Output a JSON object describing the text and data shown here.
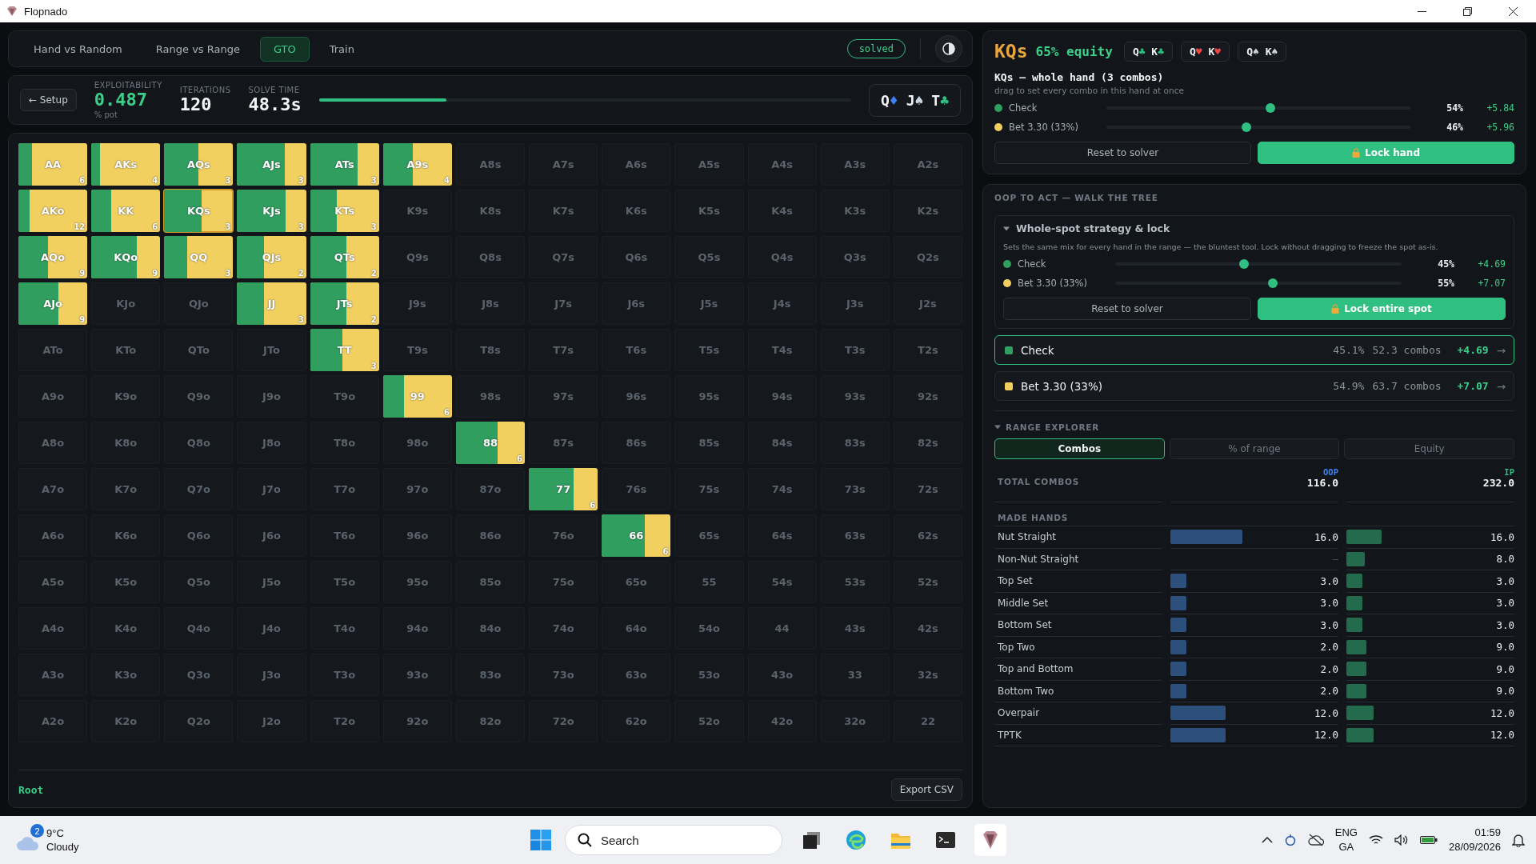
{
  "window": {
    "title": "Flopnado"
  },
  "nav": {
    "tabs": [
      {
        "label": "Hand vs Random",
        "selected": false
      },
      {
        "label": "Range vs Range",
        "selected": false
      },
      {
        "label": "GTO",
        "selected": true
      },
      {
        "label": "Train",
        "selected": false
      }
    ],
    "status": "solved"
  },
  "stats": {
    "back": "← Setup",
    "exploitability": {
      "label": "EXPLOITABILITY",
      "value": "0.487",
      "unit": "% pot"
    },
    "iterations": {
      "label": "ITERATIONS",
      "value": "120"
    },
    "solve_time": {
      "label": "SOLVE TIME",
      "value": "48.3s"
    },
    "progress": {
      "level": 0.24
    },
    "board": [
      {
        "rank": "Q",
        "suit": "♦",
        "color": "#3b82f6"
      },
      {
        "rank": "J",
        "suit": "♠",
        "color": "#cbd5e1"
      },
      {
        "rank": "T",
        "suit": "♣",
        "color": "#2fbf80"
      }
    ]
  },
  "grid": {
    "rows": [
      [
        {
          "label": "AA",
          "selected": false,
          "level": 0.2,
          "count": "6"
        },
        {
          "label": "AKs",
          "selected": false,
          "level": 0.13,
          "count": "4"
        },
        {
          "label": "AQs",
          "selected": false,
          "level": 0.5,
          "count": "3"
        },
        {
          "label": "AJs",
          "selected": false,
          "level": 0.69,
          "count": "3"
        },
        {
          "label": "ATs",
          "selected": false,
          "level": 0.69,
          "count": "3"
        },
        {
          "label": "A9s",
          "selected": false,
          "level": 0.43,
          "count": "4"
        },
        {
          "label": "A8s",
          "selected": false
        },
        {
          "label": "A7s",
          "selected": false
        },
        {
          "label": "A6s",
          "selected": false
        },
        {
          "label": "A5s",
          "selected": false
        },
        {
          "label": "A4s",
          "selected": false
        },
        {
          "label": "A3s",
          "selected": false
        },
        {
          "label": "A2s",
          "selected": false
        }
      ],
      [
        {
          "label": "AKo",
          "selected": false,
          "level": 0.16,
          "count": "12"
        },
        {
          "label": "KK",
          "selected": false,
          "level": 0.29,
          "count": "6"
        },
        {
          "label": "KQs",
          "selected": true,
          "level": 0.54,
          "count": "3"
        },
        {
          "label": "KJs",
          "selected": false,
          "level": 0.7,
          "count": "3"
        },
        {
          "label": "KTs",
          "selected": false,
          "level": 0.39,
          "count": "3"
        },
        {
          "label": "K9s",
          "selected": false
        },
        {
          "label": "K8s",
          "selected": false
        },
        {
          "label": "K7s",
          "selected": false
        },
        {
          "label": "K6s",
          "selected": false
        },
        {
          "label": "K5s",
          "selected": false
        },
        {
          "label": "K4s",
          "selected": false
        },
        {
          "label": "K3s",
          "selected": false
        },
        {
          "label": "K2s",
          "selected": false
        }
      ],
      [
        {
          "label": "AQo",
          "selected": false,
          "level": 0.43,
          "count": "9"
        },
        {
          "label": "KQo",
          "selected": false,
          "level": 0.66,
          "count": "9"
        },
        {
          "label": "QQ",
          "selected": false,
          "level": 0.33,
          "count": "3"
        },
        {
          "label": "QJs",
          "selected": false,
          "level": 0.39,
          "count": "2"
        },
        {
          "label": "QTs",
          "selected": false,
          "level": 0.53,
          "count": "2"
        },
        {
          "label": "Q9s",
          "selected": false
        },
        {
          "label": "Q8s",
          "selected": false
        },
        {
          "label": "Q7s",
          "selected": false
        },
        {
          "label": "Q6s",
          "selected": false
        },
        {
          "label": "Q5s",
          "selected": false
        },
        {
          "label": "Q4s",
          "selected": false
        },
        {
          "label": "Q3s",
          "selected": false
        },
        {
          "label": "Q2s",
          "selected": false
        }
      ],
      [
        {
          "label": "AJo",
          "selected": false,
          "level": 0.58,
          "count": "9"
        },
        {
          "label": "KJo",
          "selected": false
        },
        {
          "label": "QJo",
          "selected": false
        },
        {
          "label": "JJ",
          "selected": false,
          "level": 0.39,
          "count": "3"
        },
        {
          "label": "JTs",
          "selected": false,
          "level": 0.53,
          "count": "2"
        },
        {
          "label": "J9s",
          "selected": false
        },
        {
          "label": "J8s",
          "selected": false
        },
        {
          "label": "J7s",
          "selected": false
        },
        {
          "label": "J6s",
          "selected": false
        },
        {
          "label": "J5s",
          "selected": false
        },
        {
          "label": "J4s",
          "selected": false
        },
        {
          "label": "J3s",
          "selected": false
        },
        {
          "label": "J2s",
          "selected": false
        }
      ],
      [
        {
          "label": "ATo",
          "selected": false
        },
        {
          "label": "KTo",
          "selected": false
        },
        {
          "label": "QTo",
          "selected": false
        },
        {
          "label": "JTo",
          "selected": false
        },
        {
          "label": "TT",
          "selected": false,
          "level": 0.47,
          "count": "3"
        },
        {
          "label": "T9s",
          "selected": false
        },
        {
          "label": "T8s",
          "selected": false
        },
        {
          "label": "T7s",
          "selected": false
        },
        {
          "label": "T6s",
          "selected": false
        },
        {
          "label": "T5s",
          "selected": false
        },
        {
          "label": "T4s",
          "selected": false
        },
        {
          "label": "T3s",
          "selected": false
        },
        {
          "label": "T2s",
          "selected": false
        }
      ],
      [
        {
          "label": "A9o",
          "selected": false
        },
        {
          "label": "K9o",
          "selected": false
        },
        {
          "label": "Q9o",
          "selected": false
        },
        {
          "label": "J9o",
          "selected": false
        },
        {
          "label": "T9o",
          "selected": false
        },
        {
          "label": "99",
          "selected": false,
          "level": 0.3,
          "count": "6"
        },
        {
          "label": "98s",
          "selected": false
        },
        {
          "label": "97s",
          "selected": false
        },
        {
          "label": "96s",
          "selected": false
        },
        {
          "label": "95s",
          "selected": false
        },
        {
          "label": "94s",
          "selected": false
        },
        {
          "label": "93s",
          "selected": false
        },
        {
          "label": "92s",
          "selected": false
        }
      ],
      [
        {
          "label": "A8o",
          "selected": false
        },
        {
          "label": "K8o",
          "selected": false
        },
        {
          "label": "Q8o",
          "selected": false
        },
        {
          "label": "J8o",
          "selected": false
        },
        {
          "label": "T8o",
          "selected": false
        },
        {
          "label": "98o",
          "selected": false
        },
        {
          "label": "88",
          "selected": false,
          "level": 0.6,
          "count": "6"
        },
        {
          "label": "87s",
          "selected": false
        },
        {
          "label": "86s",
          "selected": false
        },
        {
          "label": "85s",
          "selected": false
        },
        {
          "label": "84s",
          "selected": false
        },
        {
          "label": "83s",
          "selected": false
        },
        {
          "label": "82s",
          "selected": false
        }
      ],
      [
        {
          "label": "A7o",
          "selected": false
        },
        {
          "label": "K7o",
          "selected": false
        },
        {
          "label": "Q7o",
          "selected": false
        },
        {
          "label": "J7o",
          "selected": false
        },
        {
          "label": "T7o",
          "selected": false
        },
        {
          "label": "97o",
          "selected": false
        },
        {
          "label": "87o",
          "selected": false
        },
        {
          "label": "77",
          "selected": false,
          "level": 0.65,
          "count": "6"
        },
        {
          "label": "76s",
          "selected": false
        },
        {
          "label": "75s",
          "selected": false
        },
        {
          "label": "74s",
          "selected": false
        },
        {
          "label": "73s",
          "selected": false
        },
        {
          "label": "72s",
          "selected": false
        }
      ],
      [
        {
          "label": "A6o",
          "selected": false
        },
        {
          "label": "K6o",
          "selected": false
        },
        {
          "label": "Q6o",
          "selected": false
        },
        {
          "label": "J6o",
          "selected": false
        },
        {
          "label": "T6o",
          "selected": false
        },
        {
          "label": "96o",
          "selected": false
        },
        {
          "label": "86o",
          "selected": false
        },
        {
          "label": "76o",
          "selected": false
        },
        {
          "label": "66",
          "selected": false,
          "level": 0.63,
          "count": "6"
        },
        {
          "label": "65s",
          "selected": false
        },
        {
          "label": "64s",
          "selected": false
        },
        {
          "label": "63s",
          "selected": false
        },
        {
          "label": "62s",
          "selected": false
        }
      ],
      [
        {
          "label": "A5o",
          "selected": false
        },
        {
          "label": "K5o",
          "selected": false
        },
        {
          "label": "Q5o",
          "selected": false
        },
        {
          "label": "J5o",
          "selected": false
        },
        {
          "label": "T5o",
          "selected": false
        },
        {
          "label": "95o",
          "selected": false
        },
        {
          "label": "85o",
          "selected": false
        },
        {
          "label": "75o",
          "selected": false
        },
        {
          "label": "65o",
          "selected": false
        },
        {
          "label": "55",
          "selected": false
        },
        {
          "label": "54s",
          "selected": false
        },
        {
          "label": "53s",
          "selected": false
        },
        {
          "label": "52s",
          "selected": false
        }
      ],
      [
        {
          "label": "A4o",
          "selected": false
        },
        {
          "label": "K4o",
          "selected": false
        },
        {
          "label": "Q4o",
          "selected": false
        },
        {
          "label": "J4o",
          "selected": false
        },
        {
          "label": "T4o",
          "selected": false
        },
        {
          "label": "94o",
          "selected": false
        },
        {
          "label": "84o",
          "selected": false
        },
        {
          "label": "74o",
          "selected": false
        },
        {
          "label": "64o",
          "selected": false
        },
        {
          "label": "54o",
          "selected": false
        },
        {
          "label": "44",
          "selected": false
        },
        {
          "label": "43s",
          "selected": false
        },
        {
          "label": "42s",
          "selected": false
        }
      ],
      [
        {
          "label": "A3o",
          "selected": false
        },
        {
          "label": "K3o",
          "selected": false
        },
        {
          "label": "Q3o",
          "selected": false
        },
        {
          "label": "J3o",
          "selected": false
        },
        {
          "label": "T3o",
          "selected": false
        },
        {
          "label": "93o",
          "selected": false
        },
        {
          "label": "83o",
          "selected": false
        },
        {
          "label": "73o",
          "selected": false
        },
        {
          "label": "63o",
          "selected": false
        },
        {
          "label": "53o",
          "selected": false
        },
        {
          "label": "43o",
          "selected": false
        },
        {
          "label": "33",
          "selected": false
        },
        {
          "label": "32s",
          "selected": false
        }
      ],
      [
        {
          "label": "A2o",
          "selected": false
        },
        {
          "label": "K2o",
          "selected": false
        },
        {
          "label": "Q2o",
          "selected": false
        },
        {
          "label": "J2o",
          "selected": false
        },
        {
          "label": "T2o",
          "selected": false
        },
        {
          "label": "92o",
          "selected": false
        },
        {
          "label": "82o",
          "selected": false
        },
        {
          "label": "72o",
          "selected": false
        },
        {
          "label": "62o",
          "selected": false
        },
        {
          "label": "52o",
          "selected": false
        },
        {
          "label": "42o",
          "selected": false
        },
        {
          "label": "32o",
          "selected": false
        },
        {
          "label": "22",
          "selected": false
        }
      ]
    ]
  },
  "footer": {
    "path": "Root",
    "export": "Export CSV"
  },
  "hand_panel": {
    "hand": "KQs",
    "equity": "65% equity",
    "combos": [
      {
        "cards": [
          {
            "rank": "Q",
            "suit": "♣",
            "color": "#2fbf80"
          },
          {
            "rank": "K",
            "suit": "♣",
            "color": "#2fbf80"
          }
        ]
      },
      {
        "cards": [
          {
            "rank": "Q",
            "suit": "♥",
            "color": "#ef4444"
          },
          {
            "rank": "K",
            "suit": "♥",
            "color": "#ef4444"
          }
        ]
      },
      {
        "cards": [
          {
            "rank": "Q",
            "suit": "♠",
            "color": "#cbd5e1"
          },
          {
            "rank": "K",
            "suit": "♠",
            "color": "#cbd5e1"
          }
        ]
      }
    ],
    "title": "KQs — whole hand (3 combos)",
    "hint": "drag to set every combo in this hand at once",
    "actions": [
      {
        "name": "Check",
        "color": "#2f9e5f",
        "level": 0.54,
        "pct": "54%",
        "ev": "+5.84"
      },
      {
        "name": "Bet 3.30 (33%)",
        "color": "#f2d060",
        "level": 0.46,
        "pct": "46%",
        "ev": "+5.96"
      }
    ],
    "buttons": [
      {
        "label": "Reset to solver",
        "kind": "plain"
      },
      {
        "label": "Lock hand",
        "kind": "lock"
      }
    ]
  },
  "tree": {
    "heading": "OOP TO ACT — WALK THE TREE",
    "spot": {
      "title": "Whole-spot strategy & lock",
      "expanded": true,
      "description": "Sets the same mix for every hand in the range — the bluntest tool. Lock without dragging to freeze the spot as-is.",
      "actions": [
        {
          "name": "Check",
          "color": "#2f9e5f",
          "level": 0.45,
          "pct": "45%",
          "ev": "+4.69"
        },
        {
          "name": "Bet 3.30 (33%)",
          "color": "#f2d060",
          "level": 0.55,
          "pct": "55%",
          "ev": "+7.07"
        }
      ],
      "buttons": [
        {
          "label": "Reset to solver",
          "kind": "plain"
        },
        {
          "label": "Lock entire spot",
          "kind": "lock"
        }
      ]
    },
    "nodes": [
      {
        "name": "Check",
        "color": "#2f9e5f",
        "freq": "45.1%",
        "combos": "52.3 combos",
        "ev": "+4.69",
        "arrow": "→",
        "selected": true
      },
      {
        "name": "Bet 3.30 (33%)",
        "color": "#f2d060",
        "freq": "54.9%",
        "combos": "63.7 combos",
        "ev": "+7.07",
        "arrow": "→",
        "selected": false
      }
    ]
  },
  "range_explorer": {
    "heading": "RANGE EXPLORER",
    "expanded": true,
    "tabs": [
      {
        "label": "Combos",
        "selected": true
      },
      {
        "label": "% of range",
        "selected": false
      },
      {
        "label": "Equity",
        "selected": false
      }
    ],
    "columns": [
      "OOP",
      "IP"
    ],
    "total": {
      "label": "TOTAL COMBOS",
      "oop": "116.0",
      "ip": "232.0"
    },
    "section": "MADE HANDS",
    "rows": [
      {
        "label": "Nut Straight",
        "oop": {
          "value": "16.0",
          "level": 0.43
        },
        "ip": {
          "value": "16.0",
          "level": 0.21
        }
      },
      {
        "label": "Non-Nut Straight",
        "oop": {
          "value": "–",
          "level": 0
        },
        "ip": {
          "value": "8.0",
          "level": 0.11
        }
      },
      {
        "label": "Top Set",
        "oop": {
          "value": "3.0",
          "level": 0.095
        },
        "ip": {
          "value": "3.0",
          "level": 0.094
        }
      },
      {
        "label": "Middle Set",
        "oop": {
          "value": "3.0",
          "level": 0.095
        },
        "ip": {
          "value": "3.0",
          "level": 0.094
        }
      },
      {
        "label": "Bottom Set",
        "oop": {
          "value": "3.0",
          "level": 0.095
        },
        "ip": {
          "value": "3.0",
          "level": 0.094
        }
      },
      {
        "label": "Top Two",
        "oop": {
          "value": "2.0",
          "level": 0.095
        },
        "ip": {
          "value": "9.0",
          "level": 0.12
        }
      },
      {
        "label": "Top and Bottom",
        "oop": {
          "value": "2.0",
          "level": 0.095
        },
        "ip": {
          "value": "9.0",
          "level": 0.12
        }
      },
      {
        "label": "Bottom Two",
        "oop": {
          "value": "2.0",
          "level": 0.095
        },
        "ip": {
          "value": "9.0",
          "level": 0.12
        }
      },
      {
        "label": "Overpair",
        "oop": {
          "value": "12.0",
          "level": 0.33
        },
        "ip": {
          "value": "12.0",
          "level": 0.16
        }
      },
      {
        "label": "TPTK",
        "oop": {
          "value": "12.0",
          "level": 0.33
        },
        "ip": {
          "value": "12.0",
          "level": 0.16
        }
      }
    ]
  },
  "taskbar": {
    "weather": {
      "badge": "2",
      "temp": "9°C",
      "condition": "Cloudy"
    },
    "search": {
      "placeholder": "Search"
    },
    "tray": {
      "language": "ENG",
      "layout": "GA",
      "time": "01:59",
      "date": "28/09/2026"
    }
  }
}
